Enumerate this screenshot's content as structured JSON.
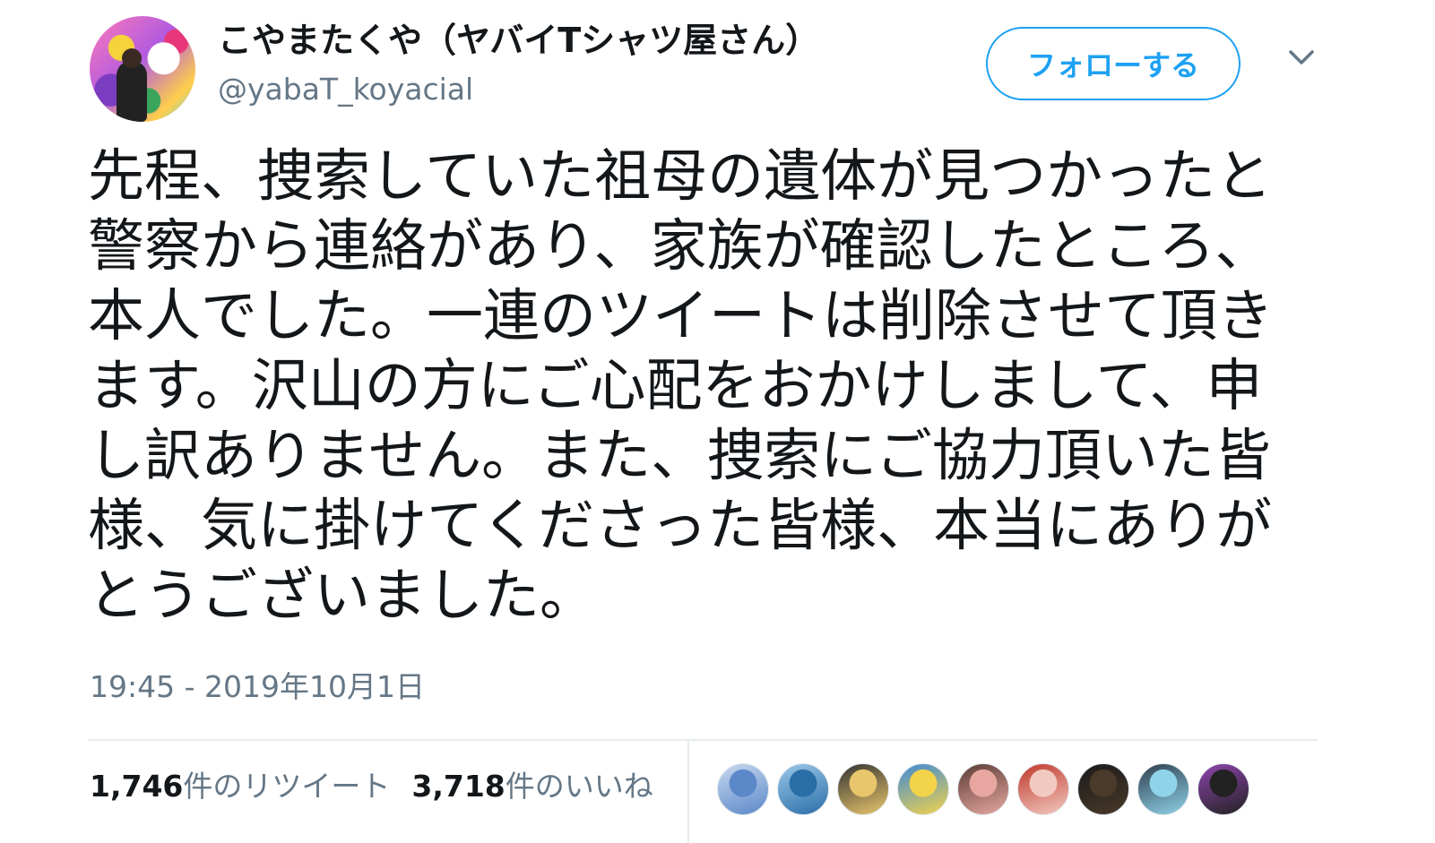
{
  "author": {
    "display_name": "こやまたくや（ヤバイTシャツ屋さん）",
    "handle": "@yabaT_koyacial"
  },
  "follow_button": {
    "label": "フォローする"
  },
  "tweet": {
    "text": "先程、捜索していた祖母の遺体が見つかったと警察から連絡があり、家族が確認したところ、本人でした。一連のツイートは削除させて頂きます。沢山の方にご心配をおかけしまして、申し訳ありません。また、捜索にご協力頂いた皆様、気に掛けてくださった皆様、本当にありがとうございました。",
    "timestamp": "19:45 - 2019年10月1日"
  },
  "stats": {
    "retweets_count": "1,746",
    "retweets_label": "件のリツイート",
    "likes_count": "3,718",
    "likes_label": "件のいいね"
  },
  "liker_avatars": [
    {
      "name": "liker-1",
      "colors": [
        "#5b88c9",
        "#c8d8ee"
      ]
    },
    {
      "name": "liker-2",
      "colors": [
        "#2a6ea8",
        "#9cc7e8"
      ]
    },
    {
      "name": "liker-3",
      "colors": [
        "#e8c66b",
        "#333333"
      ]
    },
    {
      "name": "liker-4",
      "colors": [
        "#f3d34a",
        "#3e8ad6"
      ]
    },
    {
      "name": "liker-5",
      "colors": [
        "#e7a7a0",
        "#5a3d35"
      ]
    },
    {
      "name": "liker-6",
      "colors": [
        "#f2c9c0",
        "#c0392b"
      ]
    },
    {
      "name": "liker-7",
      "colors": [
        "#4a3a2a",
        "#1a1a1a"
      ]
    },
    {
      "name": "liker-8",
      "colors": [
        "#8fd3e8",
        "#2f3f4f"
      ]
    },
    {
      "name": "liker-9",
      "colors": [
        "#222222",
        "#8e44ad"
      ]
    }
  ],
  "colors": {
    "accent": "#1da1f2",
    "secondary_text": "#657786",
    "primary_text": "#14171a"
  }
}
